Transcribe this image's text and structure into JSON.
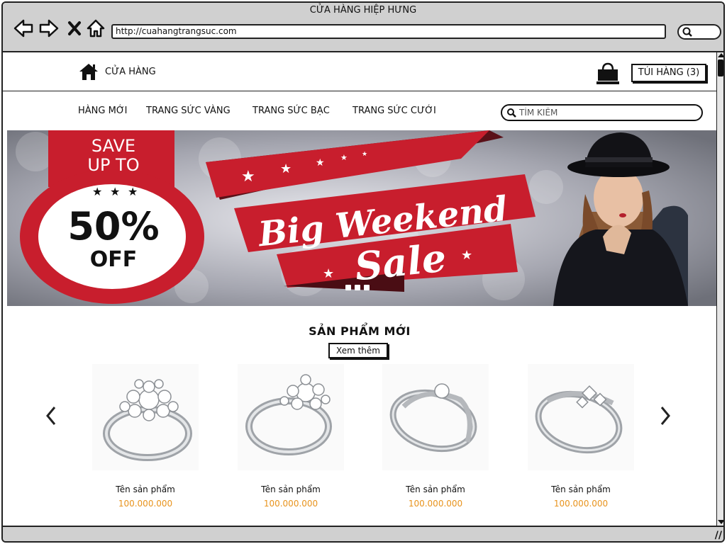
{
  "window": {
    "title": "CỬA HÀNG HIỆP HƯNG",
    "url": "http://cuahangtrangsuc.com"
  },
  "header": {
    "home_label": "CỬA HÀNG",
    "cart_label": "TÚI HÀNG (3)"
  },
  "menu": {
    "items": [
      "HÀNG MỚI",
      "TRANG SỨC VÀNG",
      "TRANG SỨC BẠC",
      "TRANG SỨC CƯỚI"
    ],
    "search_placeholder": "TÌM KIẾM"
  },
  "banner": {
    "save_line1": "SAVE",
    "save_line2": "UP TO",
    "discount": "50%",
    "off": "OFF",
    "headline1": "Big Weekend",
    "headline2": "Sale",
    "accent_color": "#c81e2d"
  },
  "products_section": {
    "title": "SẢN PHẨM MỚI",
    "more_label": "Xem thêm",
    "price_color": "#e8931c",
    "products": [
      {
        "name": "Tên sản phẩm",
        "price": "100.000.000"
      },
      {
        "name": "Tên sản phẩm",
        "price": "100.000.000"
      },
      {
        "name": "Tên sản phẩm",
        "price": "100.000.000"
      },
      {
        "name": "Tên sản phẩm",
        "price": "100.000.000"
      }
    ]
  }
}
